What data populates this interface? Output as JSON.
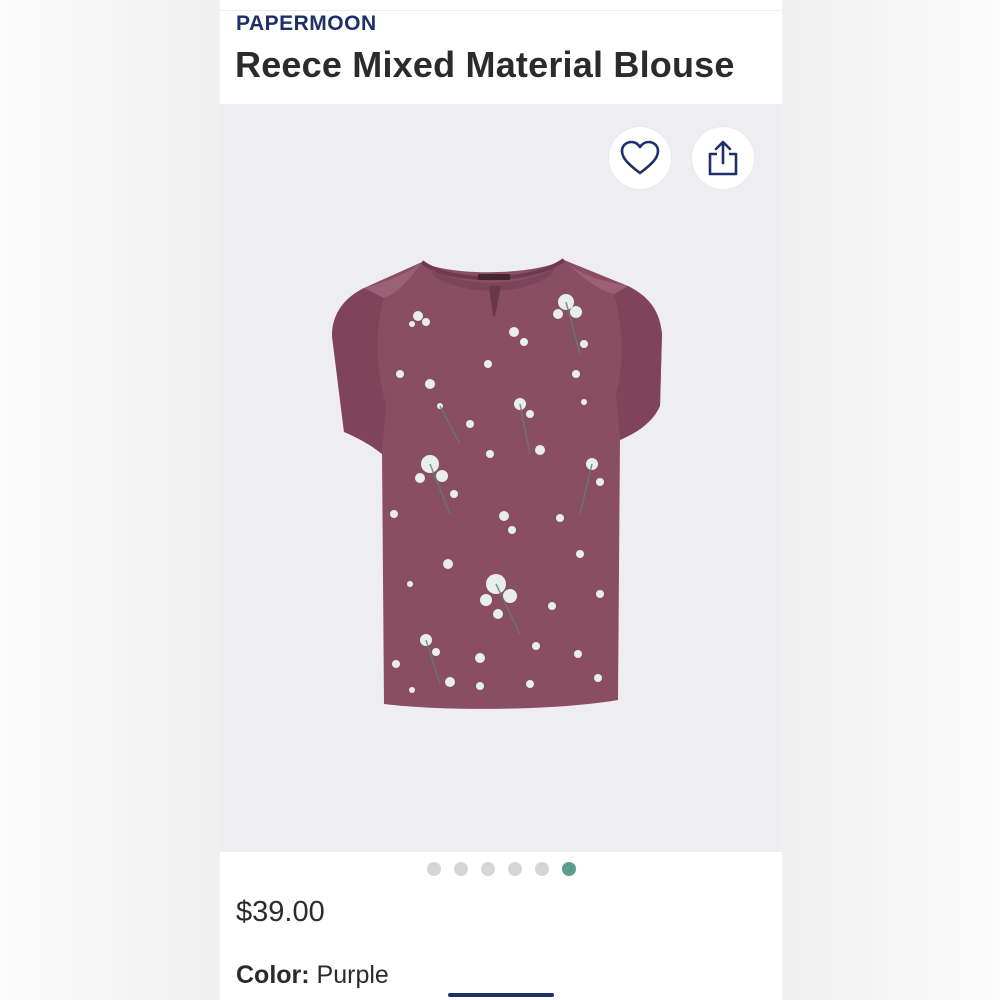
{
  "product": {
    "brand": "PAPERMOON",
    "title": "Reece Mixed Material Blouse",
    "price": "$39.00",
    "color_label": "Color:",
    "color_value": "Purple"
  },
  "actions": {
    "favorite_icon": "heart-icon",
    "share_icon": "share-icon"
  },
  "gallery": {
    "image_count": 6,
    "active_index": 5,
    "image_description": "purple floral blouse"
  },
  "colors": {
    "brand": "#1f2f6a",
    "active_dot": "#5b9e8f",
    "garment": "#8a4e63"
  }
}
